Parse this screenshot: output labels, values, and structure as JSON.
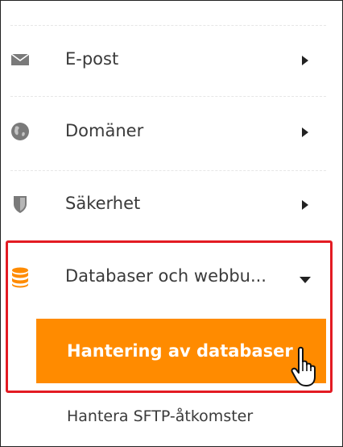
{
  "menu": {
    "items": [
      {
        "label": "E-post",
        "icon": "envelope-icon",
        "expanded": false
      },
      {
        "label": "Domäner",
        "icon": "globe-icon",
        "expanded": false
      },
      {
        "label": "Säkerhet",
        "icon": "shield-icon",
        "expanded": false
      },
      {
        "label": "Databaser och webbu...",
        "icon": "database-icon",
        "expanded": true
      }
    ],
    "submenu": {
      "active_label": "Hantering av databaser",
      "items": [
        {
          "label": "Hantera SFTP-åtkomster"
        }
      ]
    }
  },
  "colors": {
    "icon_gray": "#7a7a7a",
    "accent_orange": "#ff8b00",
    "highlight_red": "#e31b23",
    "text": "#3a3a3a"
  }
}
